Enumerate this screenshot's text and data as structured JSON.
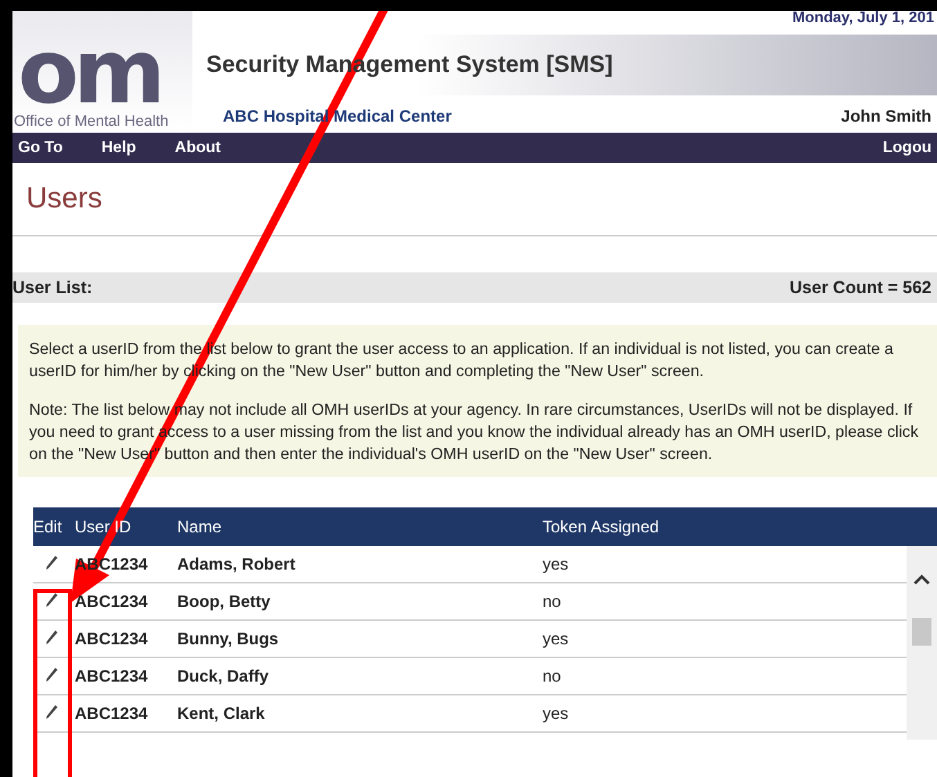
{
  "header": {
    "date": "Monday, July 1, 201",
    "logo_text": "om",
    "logo_caption": "Office of Mental Health",
    "title": "Security Management System [SMS]",
    "facility": "ABC Hospital Medical Center",
    "user": "John Smith"
  },
  "nav": {
    "items": [
      "Go To",
      "Help",
      "About"
    ],
    "logout": "Logou"
  },
  "page_title": "Users",
  "list_bar": {
    "label": "User List:",
    "count": "User Count = 562"
  },
  "notes": [
    "Select a userID from the list below to grant the user access to an application. If an individual is not listed, you can create a userID for him/her by clicking on the \"New User\" button and completing the \"New User\" screen.",
    "Note:  The list below may not include all OMH userIDs at your agency.  In rare circumstances, UserIDs will not be displayed.  If you need to grant access to a user missing from the list and you know the individual already has an OMH userID, please click on the \"New User\" button and then enter the individual's OMH userID on the \"New User\" screen."
  ],
  "table": {
    "columns": [
      "Edit",
      "User ID",
      "Name",
      "Token Assigned"
    ],
    "rows": [
      {
        "user_id": "ABC1234",
        "name": "Adams, Robert",
        "token": "yes"
      },
      {
        "user_id": "ABC1234",
        "name": "Boop, Betty",
        "token": "no"
      },
      {
        "user_id": "ABC1234",
        "name": "Bunny, Bugs",
        "token": "yes"
      },
      {
        "user_id": "ABC1234",
        "name": "Duck, Daffy",
        "token": "no"
      },
      {
        "user_id": "ABC1234",
        "name": "Kent, Clark",
        "token": "yes"
      }
    ]
  }
}
